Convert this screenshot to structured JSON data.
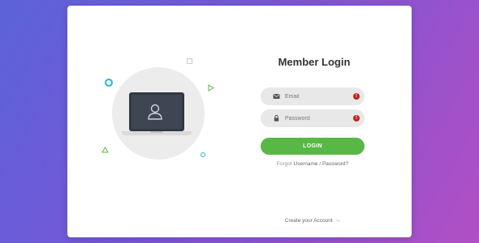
{
  "form": {
    "title": "Member Login",
    "email_placeholder": "Email",
    "password_placeholder": "Password",
    "error_glyph": "!",
    "login_label": "LOGIN",
    "forgot_prefix": "Forgot",
    "forgot_username": "Username",
    "forgot_separator": "/",
    "forgot_password": "Password?",
    "create_account_label": "Create your Account",
    "create_account_arrow": "→"
  },
  "icons": {
    "email": "envelope-icon",
    "password": "lock-icon",
    "error": "exclamation-icon",
    "illustration": "laptop-user-icon"
  },
  "colors": {
    "login_button": "#57b846",
    "error": "#c0221b",
    "accent_cyan": "#28b6d9",
    "accent_green": "#57b846"
  }
}
